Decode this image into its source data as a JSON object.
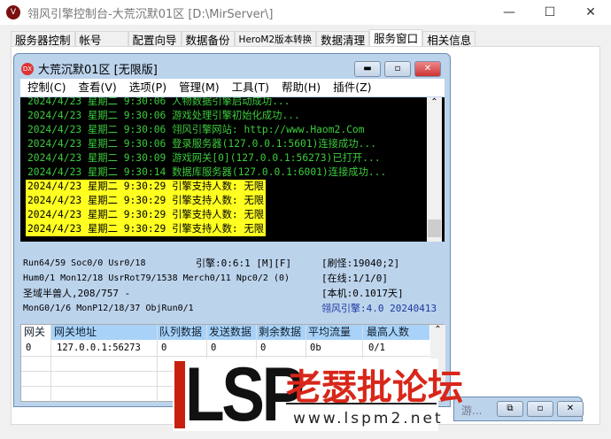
{
  "app": {
    "title": "翎风引擎控制台-大荒沉默01区 [D:\\MirServer\\]",
    "min": "—",
    "max": "☐",
    "close": "✕"
  },
  "tabs": [
    "服务器控制",
    "帐号",
    "配置向导",
    "数据备份",
    "HeroM2版本转换",
    "数据清理",
    "服务窗口",
    "相关信息"
  ],
  "active_tab": "服务窗口",
  "mdi": {
    "title": "大荒沉默01区 [无限版]",
    "icon": "DX",
    "menu": [
      "控制(C)",
      "查看(V)",
      "选项(P)",
      "管理(M)",
      "工具(T)",
      "帮助(H)",
      "插件(Z)"
    ]
  },
  "log": {
    "green": [
      "2024/4/23 星期二 9:30:06 人物数据引擎启动成功...",
      "2024/4/23 星期二 9:30:06 游戏处理引擎初始化成功...",
      "2024/4/23 星期二 9:30:06 翎风引擎网站: http://www.Haom2.Com",
      "2024/4/23 星期二 9:30:06 登录服务器(127.0.0.1:5601)连接成功...",
      "2024/4/23 星期二 9:30:09 游戏网关[0](127.0.0.1:56273)已打开...",
      "2024/4/23 星期二 9:30:14 数据库服务器(127.0.0.1:6001)连接成功..."
    ],
    "yellow": [
      "2024/4/23 星期二 9:30:29 引擎支持人数: 无限",
      "2024/4/23 星期二 9:30:29 引擎支持人数: 无限",
      "2024/4/23 星期二 9:30:29 引擎支持人数: 无限",
      "2024/4/23 星期二 9:30:29 引擎支持人数: 无限"
    ]
  },
  "status": {
    "run": "Run64/59 Soc0/0 Usr0/18",
    "engine": "引擎:0:6:1 [M][F]",
    "refresh": "[刷怪:19040;2]",
    "hum": "Hum0/1 Mon12/18 UsrRot79/1538 Merch0/11 Npc0/2 (0)",
    "online": "[在线:1/1/0]",
    "monster": "圣域半兽人,208/757 -",
    "local": "[本机:0.1017天]",
    "mong": "MonG0/1/6 MonP12/18/37 ObjRun0/1",
    "version": "翎风引擎:4.0 20240413"
  },
  "grid": {
    "headers": [
      "网关",
      "网关地址",
      "队列数据",
      "发送数据",
      "剩余数据",
      "平均流量",
      "最高人数"
    ],
    "rows": [
      [
        "0",
        "127.0.0.1:56273",
        "0",
        "0",
        "0",
        "0b",
        "0/1"
      ]
    ]
  },
  "mini": {
    "title": "游..."
  },
  "watermark": {
    "logo": "LSP",
    "text": "老瑟批论坛",
    "url": "www.lspm2.net"
  }
}
